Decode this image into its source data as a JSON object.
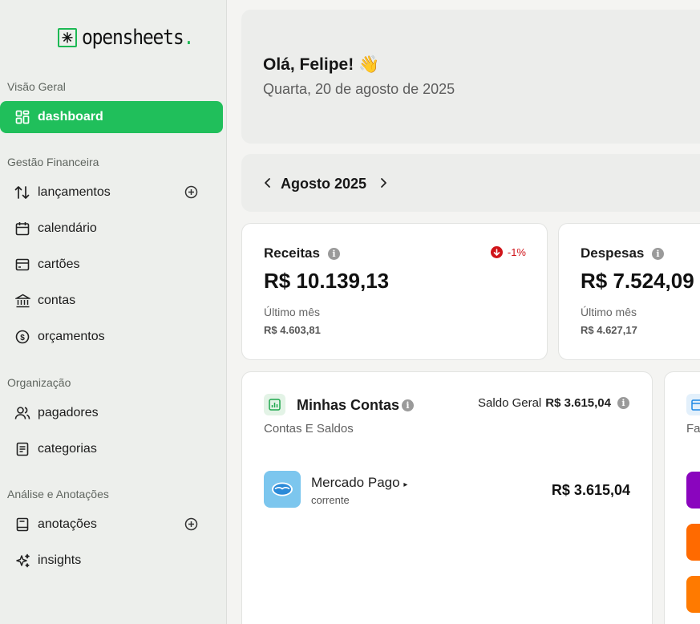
{
  "brand": {
    "name": "opensheets",
    "dot": "."
  },
  "sidebar": {
    "sections": [
      {
        "title": "Visão Geral"
      },
      {
        "title": "Gestão Financeira"
      },
      {
        "title": "Organização"
      },
      {
        "title": "Análise e Anotações"
      }
    ],
    "items": [
      {
        "label": "dashboard",
        "icon": "dashboard-icon",
        "active": true
      },
      {
        "label": "lançamentos",
        "icon": "arrows-updown-icon",
        "has_add": true
      },
      {
        "label": "calendário",
        "icon": "calendar-icon"
      },
      {
        "label": "cartões",
        "icon": "credit-card-icon"
      },
      {
        "label": "contas",
        "icon": "bank-icon"
      },
      {
        "label": "orçamentos",
        "icon": "dollar-circle-icon"
      },
      {
        "label": "pagadores",
        "icon": "users-icon"
      },
      {
        "label": "categorias",
        "icon": "list-icon"
      },
      {
        "label": "anotações",
        "icon": "notebook-icon",
        "has_add": true
      },
      {
        "label": "insights",
        "icon": "sparkles-icon"
      }
    ]
  },
  "greeting": {
    "title": "Olá, Felipe! 👋",
    "date": "Quarta, 20 de agosto de 2025"
  },
  "period": {
    "label": "Agosto 2025"
  },
  "stats": {
    "receitas": {
      "title": "Receitas",
      "value": "R$ 10.139,13",
      "delta": "-1%",
      "sub": "Último mês",
      "prev": "R$ 4.603,81"
    },
    "despesas": {
      "title": "Despesas",
      "value": "R$ 7.524,09",
      "sub": "Último mês",
      "prev": "R$ 4.627,17"
    }
  },
  "accounts": {
    "title": "Minhas Contas",
    "subtitle": "Contas E Saldos",
    "saldo_label": "Saldo Geral",
    "saldo_value": "R$ 3.615,04",
    "items": [
      {
        "name": "Mercado Pago",
        "type": "corrente",
        "value": "R$ 3.615,04"
      }
    ]
  },
  "right_panel": {
    "subtitle": "Fa"
  },
  "colors": {
    "accent": "#20bf5b",
    "negative": "#d0141a",
    "mp_blue": "#7cc6ee",
    "nubank_purple": "#8a05be",
    "orange": "#ff6a00"
  }
}
